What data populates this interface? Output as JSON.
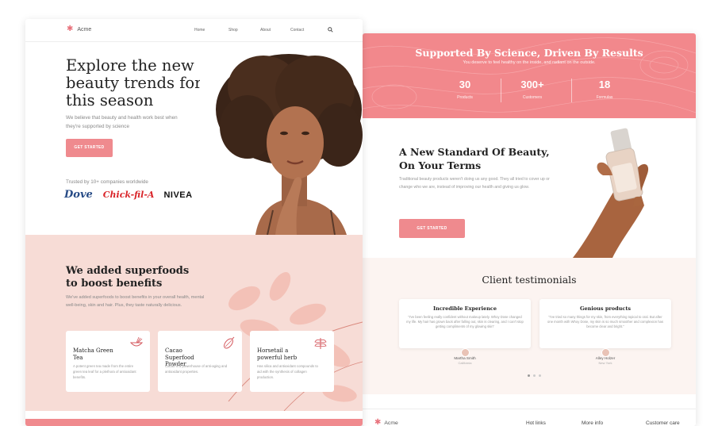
{
  "left_page": {
    "nav": {
      "logo": "Acme",
      "links": [
        "Home",
        "Shop",
        "About",
        "Contact"
      ]
    },
    "hero": {
      "title": "Explore the new beauty trends for this season",
      "subtitle": "We believe that beauty and health work best when they're supported by science",
      "cta": "GET STARTED",
      "trusted": "Trusted by 10+ companies worldwide",
      "brands": [
        "Dove",
        "Chick-fil-A",
        "NIVEA"
      ]
    },
    "superfoods": {
      "title": "We added superfoods to boost benefits",
      "body": "We've added superfoods to boost benefits in your overall health, mental well-being, skin and hair. Plus, they taste naturally delicious.",
      "cards": [
        {
          "title": "Matcha Green Tea",
          "desc": "A potent green tea made from the entire green tea leaf for a plethora of antioxidant benefits."
        },
        {
          "title": "Cacao Superfood Powder",
          "desc": "Cacao is a powerhouse of anti-aging and antioxidant properties."
        },
        {
          "title": "Horsetail a powerful herb",
          "desc": "Has silica and antioxidant compounds to aid with the synthesis of collagen production."
        }
      ]
    }
  },
  "right_page": {
    "stats": {
      "title": "Supported By Science, Driven By Results",
      "subtitle": "You deserve to feel healthy on the inside, and radiant on the outside.",
      "items": [
        {
          "value": "30",
          "label": "Products"
        },
        {
          "value": "300+",
          "label": "Customers"
        },
        {
          "value": "18",
          "label": "Formulas"
        }
      ]
    },
    "standard": {
      "title_line1": "A New Standard Of Beauty,",
      "title_line2": "On Your Terms",
      "body": "Traditional beauty products weren't doing us any good. They all tried to cover up or change who we are, instead of improving our health and giving us glow.",
      "cta": "GET STARTED"
    },
    "testimonials": {
      "title": "Client testimonials",
      "items": [
        {
          "title": "Incredible Experience",
          "quote": "\"I've been feeling really confident without makeup lately. Whoy Dose changed my life. My hair has grown back after falling out, skin is clearing, and I can't stop getting compliments of my glowing skin\"",
          "name": "Martha Smith",
          "location": "California"
        },
        {
          "title": "Genious products",
          "quote": "\"I've tried so many things for my skin, from everything topical to oral. But after one month with Whoy Dose, my skin is so much smoother and complexion has become clear and bright.\"",
          "name": "Alley Holzer",
          "location": "New York"
        }
      ]
    },
    "footer": {
      "logo": "Acme",
      "columns": [
        "Hot links",
        "More info",
        "Customer care"
      ]
    }
  },
  "colors": {
    "accent": "#f08a8e",
    "pink_bg": "#f7dcd6",
    "cream_bg": "#fcf4f1"
  }
}
